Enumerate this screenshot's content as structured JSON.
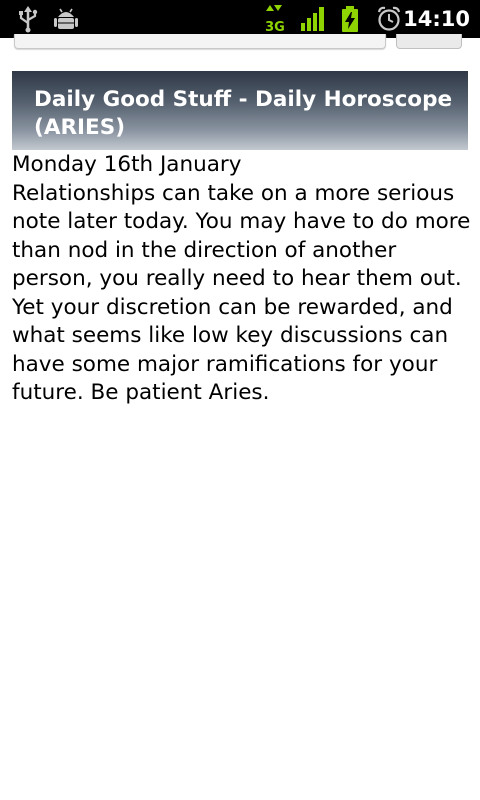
{
  "status_bar": {
    "time": "14:10",
    "network_label": "3G",
    "icons": [
      "usb-icon",
      "android-debug-icon",
      "data-3g-icon",
      "signal-icon",
      "battery-charging-icon",
      "alarm-icon"
    ]
  },
  "page": {
    "title": "Daily Good Stuff - Daily Horoscope (ARIES)",
    "date": "Monday 16th January",
    "body": "Relationships can take on a more serious note later today. You may have to do more than nod in the direction of another person, you really need to hear them out. Yet your discretion can be rewarded, and what seems like low key discussions can have some major ramifications for your future. Be patient Aries."
  },
  "colors": {
    "status_bar_bg": "#000000",
    "status_icon_green": "#8fd400",
    "header_gradient_top": "#2e3847",
    "header_gradient_bottom": "#c3c9d0",
    "header_text": "#ffffff",
    "body_text": "#000000"
  }
}
